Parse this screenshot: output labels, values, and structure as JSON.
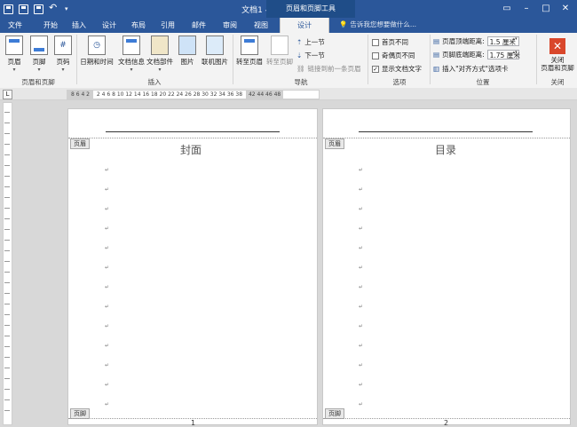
{
  "titlebar": {
    "doc_title": "文档1 - Word",
    "context_tool": "页眉和页脚工具"
  },
  "tabs": [
    "文件",
    "开始",
    "插入",
    "设计",
    "布局",
    "引用",
    "邮件",
    "审阅",
    "视图",
    "设计"
  ],
  "tell_me": "告诉我您想要做什么...",
  "ribbon": {
    "header_footer": {
      "buttons": [
        "页眉",
        "页脚",
        "页码"
      ],
      "label": "页眉和页脚"
    },
    "insert": {
      "buttons": [
        "日期和时间",
        "文档信息",
        "文档部件",
        "图片",
        "联机图片"
      ],
      "label": "插入"
    },
    "navigation": {
      "goto_header": "转至页眉",
      "goto_footer": "转至页脚",
      "prev": "上一节",
      "next": "下一节",
      "link_prev": "链接到前一条页眉",
      "label": "导航"
    },
    "options": {
      "first_page": "首页不同",
      "odd_even": "奇偶页不同",
      "show_text": "显示文档文字",
      "show_text_checked": true,
      "label": "选项"
    },
    "position": {
      "header_top": "页眉顶端距离:",
      "header_top_value": "1.5 厘米",
      "footer_bottom": "页脚底端距离:",
      "footer_bottom_value": "1.75 厘米",
      "insert_align_tab": "插入\"对齐方式\"选项卡",
      "label": "位置"
    },
    "close": {
      "button": "关闭\n页眉和页脚",
      "label": "关闭"
    }
  },
  "ruler": {
    "corner": "L",
    "left_ticks": "8 6 4 2",
    "right_ticks": "2 4 6 8 10 12 14 16 18 20 22 24 26 28 30 32 34 36 38",
    "far_ticks": "42 44 46 48"
  },
  "pages": [
    {
      "heading": "封面",
      "header_tag": "页眉",
      "footer_tag": "页脚",
      "number": "1"
    },
    {
      "heading": "目录",
      "header_tag": "页眉",
      "footer_tag": "页脚",
      "number": "2"
    }
  ],
  "para_mark": "↵"
}
